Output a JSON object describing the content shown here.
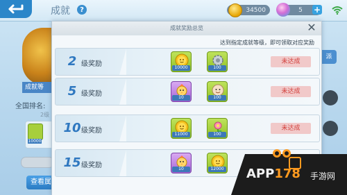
{
  "topbar": {
    "title": "成就",
    "help_glyph": "?",
    "coins": "34500",
    "gems": "5",
    "plus_glyph": "+",
    "back_icon": "back-arrow-icon",
    "coin_icon": "coin-icon",
    "gem_icon": "gem-icon",
    "wifi_icon": "wifi-icon"
  },
  "background": {
    "level_tag": "成就等",
    "rank_label": "全国排名:",
    "level_small": "2级",
    "reward_num": "10000",
    "view_button": "查看属",
    "right_button": "派"
  },
  "modal": {
    "title": "成就奖励总览",
    "close_glyph": "✕",
    "hint": "达到指定成就等级，即可领取对应奖励",
    "rows": [
      {
        "level": "2",
        "label": "级奖励",
        "rewards": [
          {
            "icon": "gold-coin-icon",
            "style": "green",
            "count": "10000"
          },
          {
            "icon": "gear-robot-icon",
            "style": "green",
            "count": "100"
          }
        ],
        "status": "未达成"
      },
      {
        "level": "5",
        "label": "级奖励",
        "rewards": [
          {
            "icon": "chicken-doll-icon",
            "style": "purple",
            "count": "10"
          },
          {
            "icon": "smiley-doll-icon",
            "style": "green",
            "count": "100"
          }
        ],
        "status": "未达成"
      },
      {
        "level": "10",
        "label": "级奖励",
        "rewards": [
          {
            "icon": "gold-coin-icon",
            "style": "green",
            "count": "11000"
          },
          {
            "icon": "cat-flower-icon",
            "style": "green",
            "count": "100"
          }
        ],
        "status": "未达成"
      },
      {
        "level": "15",
        "label": "级奖励",
        "rewards": [
          {
            "icon": "chicken-doll-icon",
            "style": "purple",
            "count": "10"
          },
          {
            "icon": "gold-coin-icon",
            "style": "green",
            "count": "12000"
          }
        ],
        "status": ""
      }
    ]
  },
  "watermark": {
    "main_prefix": "APP",
    "main_accent": "178",
    "suffix": "手游网"
  },
  "colors": {
    "accent_blue": "#2f78c0",
    "status_red": "#d2403c",
    "status_bg": "#f1c9c9",
    "reward_green": "#9fcc2e",
    "reward_purple": "#b878de"
  }
}
